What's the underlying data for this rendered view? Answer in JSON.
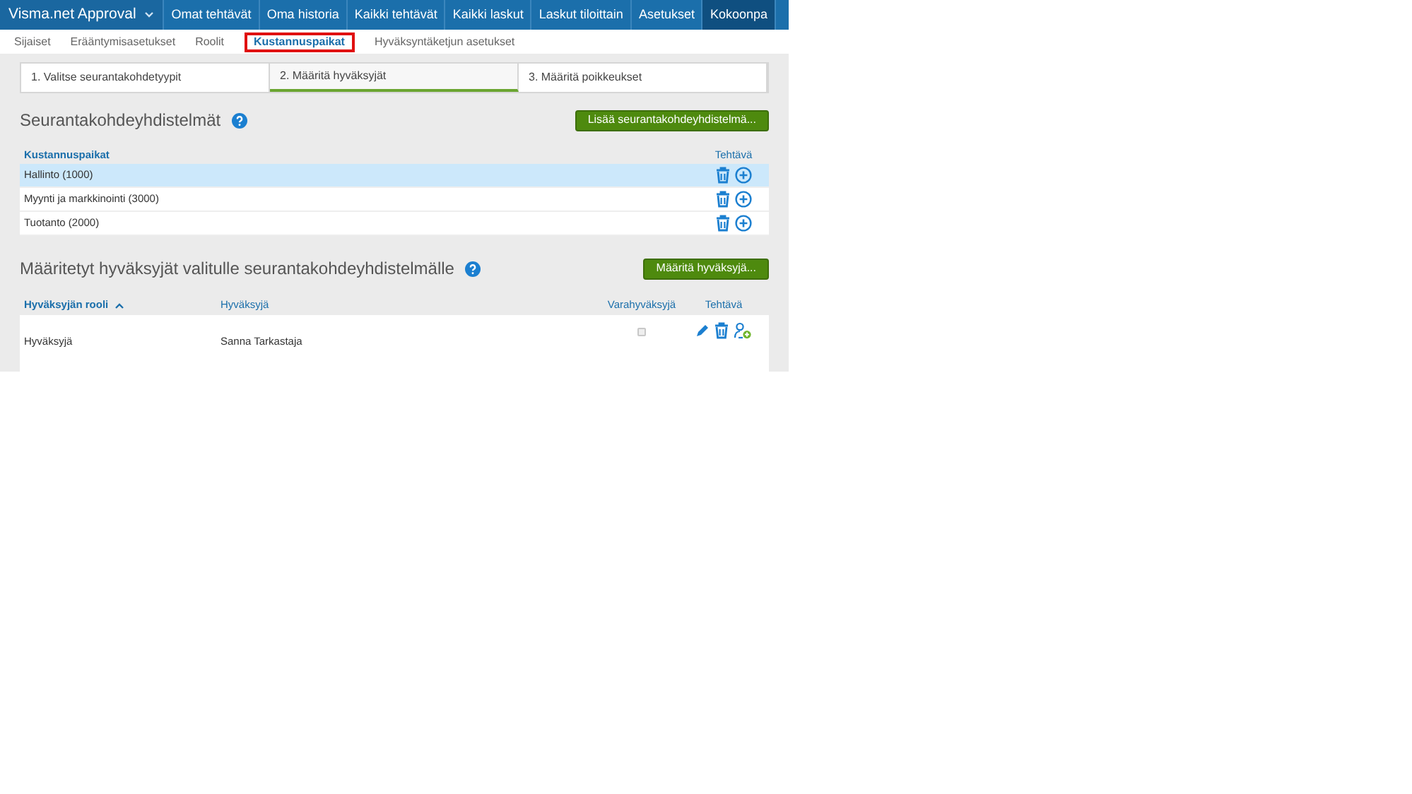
{
  "top_nav": {
    "brand": "Visma.net Approval",
    "items": [
      {
        "label": "Omat tehtävät",
        "selected": false
      },
      {
        "label": "Oma historia",
        "selected": false
      },
      {
        "label": "Kaikki tehtävät",
        "selected": false
      },
      {
        "label": "Kaikki laskut",
        "selected": false
      },
      {
        "label": "Laskut tiloittain",
        "selected": false
      },
      {
        "label": "Asetukset",
        "selected": false
      },
      {
        "label": "Kokoonpa",
        "selected": true
      }
    ]
  },
  "sub_nav": [
    {
      "label": "Sijaiset",
      "selected": false
    },
    {
      "label": "Erääntymisasetukset",
      "selected": false
    },
    {
      "label": "Roolit",
      "selected": false
    },
    {
      "label": "Kustannuspaikat",
      "selected": true
    },
    {
      "label": "Hyväksyntäketjun asetukset",
      "selected": false
    }
  ],
  "steps": [
    {
      "label": "1. Valitse seurantakohdetyypit",
      "selected": false
    },
    {
      "label": "2. Määritä hyväksyjät",
      "selected": true
    },
    {
      "label": "3. Määritä poikkeukset",
      "selected": false
    }
  ],
  "combinations": {
    "title": "Seurantakohdeyhdistelmät",
    "button": "Lisää seurantakohdeyhdistelmä...",
    "columns": [
      "Kustannuspaikat",
      "Tehtävä"
    ],
    "rows": [
      {
        "name": "Hallinto (1000)",
        "selected": true
      },
      {
        "name": "Myynti ja markkinointi (3000)",
        "selected": false
      },
      {
        "name": "Tuotanto (2000)",
        "selected": false
      }
    ]
  },
  "approvers": {
    "title": "Määritetyt hyväksyjät valitulle seurantakohdeyhdistelmälle",
    "button": "Määritä hyväksyjä...",
    "columns": [
      {
        "label": "Hyväksyjän rooli",
        "sorted": true
      },
      {
        "label": "Hyväksyjä",
        "sorted": false
      },
      {
        "label": "Varahyväksyjä",
        "sorted": false
      },
      {
        "label": "Tehtävä",
        "sorted": false
      }
    ],
    "rows": [
      {
        "role": "Hyväksyjä",
        "approver": "Sanna Tarkastaja",
        "backup": false
      }
    ]
  }
}
